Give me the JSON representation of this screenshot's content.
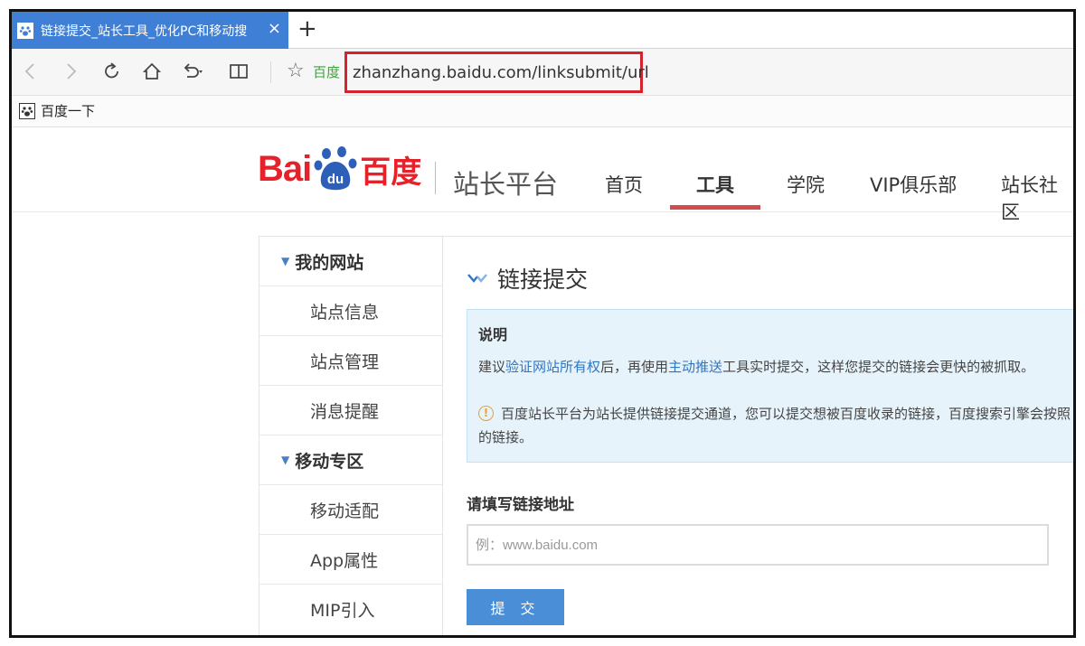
{
  "browser": {
    "tab_title": "链接提交_站长工具_优化PC和移动搜",
    "tab_close": "×",
    "new_tab": "+",
    "site_badge": "百度",
    "url": "zhanzhang.baidu.com/linksubmit/url",
    "bookmarks": [
      {
        "label": "百度一下"
      }
    ]
  },
  "header": {
    "logo_bai": "Bai",
    "logo_du": "du",
    "logo_cn": "百度",
    "platform": "站长平台",
    "nav": [
      {
        "label": "首页"
      },
      {
        "label": "工具",
        "active": true
      },
      {
        "label": "学院"
      },
      {
        "label": "VIP俱乐部"
      },
      {
        "label": "站长社区"
      }
    ]
  },
  "sidebar": {
    "groups": [
      {
        "label": "我的网站",
        "items": [
          "站点信息",
          "站点管理",
          "消息提醒"
        ]
      },
      {
        "label": "移动专区",
        "items": [
          "移动适配",
          "App属性",
          "MIP引入"
        ]
      }
    ]
  },
  "main": {
    "title": "链接提交",
    "notice": {
      "heading": "说明",
      "line1_a": "建议",
      "line1_link1": "验证网站所有权",
      "line1_b": "后，再使用",
      "line1_link2": "主动推送",
      "line1_c": "工具实时提交，这样您提交的链接会更快的被抓取。",
      "line2": "百度站长平台为站长提供链接提交通道，您可以提交想被百度收录的链接，百度搜索引擎会按照",
      "line3": "的链接。"
    },
    "field_label": "请填写链接地址",
    "input_placeholder": "例：www.baidu.com",
    "submit_label": "提 交"
  },
  "colors": {
    "tab_active": "#3f7fd6",
    "url_highlight": "#d4232e",
    "brand_red": "#e62129",
    "link_blue": "#2f76c2",
    "notice_bg": "#e7f3fb",
    "submit_bg": "#4a8ed8"
  }
}
